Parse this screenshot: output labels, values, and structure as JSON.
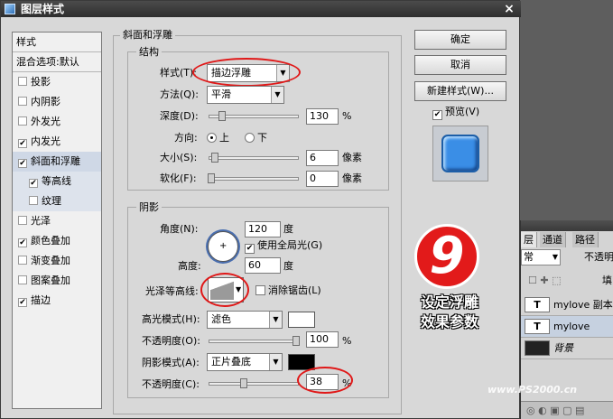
{
  "window": {
    "title": "图层样式",
    "close_glyph": "×"
  },
  "sidebar": {
    "header": "样式",
    "blend_options": "混合选项:默认",
    "items": [
      {
        "label": "投影",
        "checked": false
      },
      {
        "label": "内阴影",
        "checked": false
      },
      {
        "label": "外发光",
        "checked": false
      },
      {
        "label": "内发光",
        "checked": true
      },
      {
        "label": "斜面和浮雕",
        "checked": true,
        "selected": true
      },
      {
        "label": "等高线",
        "checked": true,
        "sub": true
      },
      {
        "label": "纹理",
        "checked": false,
        "sub": true
      },
      {
        "label": "光泽",
        "checked": false
      },
      {
        "label": "颜色叠加",
        "checked": true
      },
      {
        "label": "渐变叠加",
        "checked": false
      },
      {
        "label": "图案叠加",
        "checked": false
      },
      {
        "label": "描边",
        "checked": true
      }
    ],
    "check_glyph": "✔"
  },
  "bevel": {
    "title": "斜面和浮雕",
    "structure": {
      "title": "结构",
      "style_label": "样式(T):",
      "style_value": "描边浮雕",
      "technique_label": "方法(Q):",
      "technique_value": "平滑",
      "depth_label": "深度(D):",
      "depth_value": "130",
      "depth_unit": "%",
      "direction_label": "方向:",
      "direction_up": "上",
      "direction_down": "下",
      "size_label": "大小(S):",
      "size_value": "6",
      "size_unit": "像素",
      "soften_label": "软化(F):",
      "soften_value": "0",
      "soften_unit": "像素"
    },
    "shading": {
      "title": "阴影",
      "angle_label": "角度(N):",
      "angle_value": "120",
      "angle_unit": "度",
      "global_light_label": "使用全局光(G)",
      "altitude_label": "高度:",
      "altitude_value": "60",
      "altitude_unit": "度",
      "gloss_contour_label": "光泽等高线:",
      "antialias_label": "消除锯齿(L)",
      "highlight_mode_label": "高光模式(H):",
      "highlight_mode_value": "滤色",
      "highlight_color": "#ffffff",
      "highlight_opacity_label": "不透明度(O):",
      "highlight_opacity_value": "100",
      "highlight_opacity_unit": "%",
      "shadow_mode_label": "阴影模式(A):",
      "shadow_mode_value": "正片叠底",
      "shadow_color": "#000000",
      "shadow_opacity_label": "不透明度(C):",
      "shadow_opacity_value": "38",
      "shadow_opacity_unit": "%"
    }
  },
  "buttons": {
    "ok": "确定",
    "cancel": "取消",
    "new_style": "新建样式(W)...",
    "preview": "预览(V)"
  },
  "overlay": {
    "badge_number": "9",
    "caption_line1": "设定浮雕",
    "caption_line2": "效果参数",
    "watermark": "www.PS2000.cn"
  },
  "layers_panel": {
    "tabs": [
      "层",
      "通道",
      "路径"
    ],
    "blend_fragment": "常",
    "opacity_fragment": "不透明",
    "fill_fragment": "填",
    "layers": [
      {
        "type_glyph": "T",
        "name": "mylove 副本"
      },
      {
        "type_glyph": "T",
        "name": "mylove"
      },
      {
        "name": "背景"
      }
    ]
  },
  "colors": {
    "accent_ring": "#e01818",
    "badge": "#e21a1a",
    "preview_tile": "#3a8ee6"
  }
}
